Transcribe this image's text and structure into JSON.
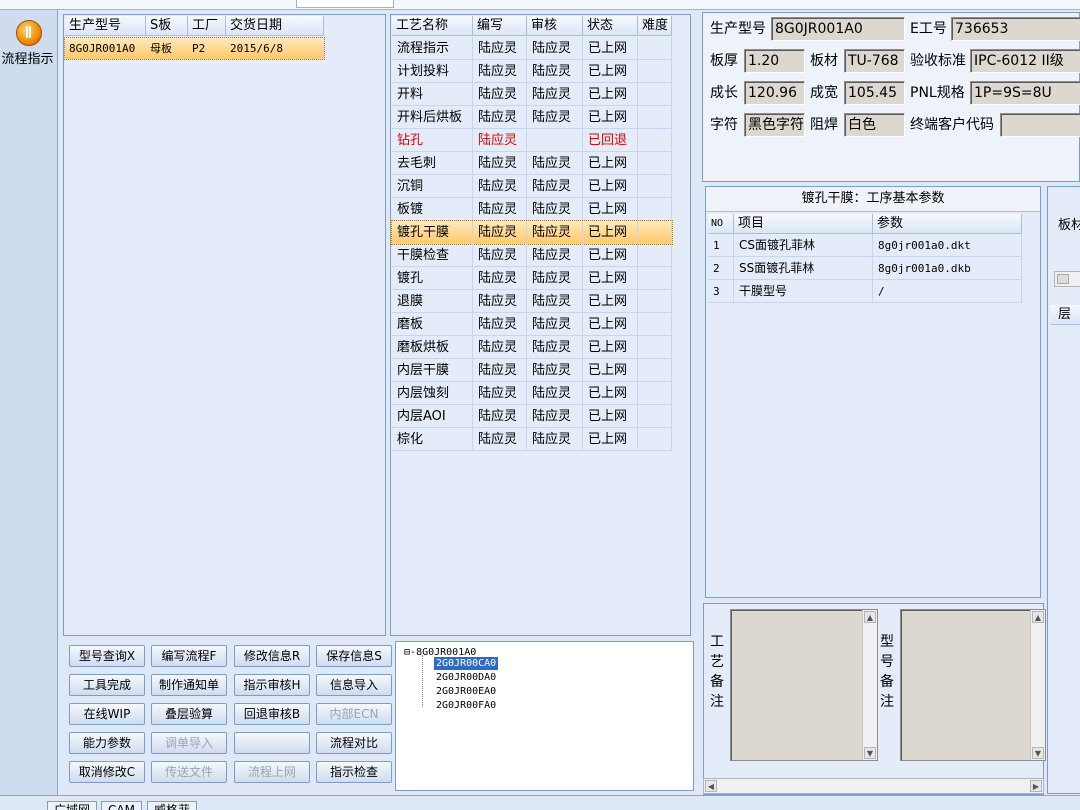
{
  "sidebar": {
    "nav_label": "流程指示"
  },
  "model_table": {
    "columns": [
      "生产型号",
      "S板",
      "工厂",
      "交货日期"
    ],
    "rows": [
      [
        "8G0JR001A0",
        "母板",
        "P2",
        "2015/6/8"
      ]
    ]
  },
  "process_table": {
    "columns": [
      "工艺名称",
      "编写",
      "审核",
      "状态",
      "难度"
    ],
    "rows": [
      [
        "流程指示",
        "陆应灵",
        "陆应灵",
        "已上网",
        ""
      ],
      [
        "计划投料",
        "陆应灵",
        "陆应灵",
        "已上网",
        ""
      ],
      [
        "开料",
        "陆应灵",
        "陆应灵",
        "已上网",
        ""
      ],
      [
        "开料后烘板",
        "陆应灵",
        "陆应灵",
        "已上网",
        ""
      ],
      [
        "钻孔",
        "陆应灵",
        "",
        "已回退",
        ""
      ],
      [
        "去毛刺",
        "陆应灵",
        "陆应灵",
        "已上网",
        ""
      ],
      [
        "沉铜",
        "陆应灵",
        "陆应灵",
        "已上网",
        ""
      ],
      [
        "板镀",
        "陆应灵",
        "陆应灵",
        "已上网",
        ""
      ],
      [
        "镀孔干膜",
        "陆应灵",
        "陆应灵",
        "已上网",
        ""
      ],
      [
        "干膜检查",
        "陆应灵",
        "陆应灵",
        "已上网",
        ""
      ],
      [
        "镀孔",
        "陆应灵",
        "陆应灵",
        "已上网",
        ""
      ],
      [
        "退膜",
        "陆应灵",
        "陆应灵",
        "已上网",
        ""
      ],
      [
        "磨板",
        "陆应灵",
        "陆应灵",
        "已上网",
        ""
      ],
      [
        "磨板烘板",
        "陆应灵",
        "陆应灵",
        "已上网",
        ""
      ],
      [
        "内层干膜",
        "陆应灵",
        "陆应灵",
        "已上网",
        ""
      ],
      [
        "内层蚀刻",
        "陆应灵",
        "陆应灵",
        "已上网",
        ""
      ],
      [
        "内层AOI",
        "陆应灵",
        "陆应灵",
        "已上网",
        ""
      ],
      [
        "棕化",
        "陆应灵",
        "陆应灵",
        "已上网",
        ""
      ]
    ],
    "selected_index": 8,
    "rolled_back_index": 4
  },
  "buttons": {
    "r1": [
      "型号查询X",
      "编写流程F",
      "修改信息R",
      "保存信息S"
    ],
    "r2": [
      "工具完成",
      "制作通知单",
      "指示审核H",
      "信息导入"
    ],
    "r3": [
      "在线WIP",
      "叠层验算",
      "回退审核B",
      "内部ECN"
    ],
    "r4": [
      "能力参数",
      "调单导入",
      "",
      "流程对比"
    ],
    "r5": [
      "取消修改C",
      "传送文件",
      "流程上网",
      "指示检查"
    ]
  },
  "tree": {
    "root": "8G0JR001A0",
    "children": [
      "2G0JR00CA0",
      "2G0JR00DA0",
      "2G0JR00EA0",
      "2G0JR00FA0"
    ]
  },
  "info": {
    "model_label": "生产型号",
    "model_value": "8G0JR001A0",
    "e_label": "E工号",
    "e_value": "736653",
    "thickness_label": "板厚",
    "thickness_value": "1.20",
    "material_label": "板材",
    "material_value": "TU-768",
    "standard_label": "验收标准",
    "standard_value": "IPC-6012 II级",
    "length_label": "成长",
    "length_value": "120.96",
    "width_label": "成宽",
    "width_value": "105.45",
    "pnl_label": "PNL规格",
    "pnl_value": "1P=9S=8U",
    "char_label": "字符",
    "char_value": "黑色字符",
    "mask_label": "阻焊",
    "mask_value": "白色",
    "customer_label": "终端客户代码",
    "customer_value": ""
  },
  "params": {
    "title": "镀孔干膜：工序基本参数",
    "columns": [
      "NO",
      "项目",
      "参数"
    ],
    "rows": [
      [
        "1",
        "CS面镀孔菲林",
        "8g0jr001a0.dkt"
      ],
      [
        "2",
        "SS面镀孔菲林",
        "8g0jr001a0.dkb"
      ],
      [
        "3",
        "干膜型号",
        "/"
      ]
    ]
  },
  "notes": {
    "process_note_label": "工艺备注",
    "model_note_label": "型号备注"
  },
  "right_panel": {
    "label1": "板材",
    "label2": "层"
  },
  "bottom_tabs": [
    "广域网",
    "CAM",
    "威格菲"
  ]
}
